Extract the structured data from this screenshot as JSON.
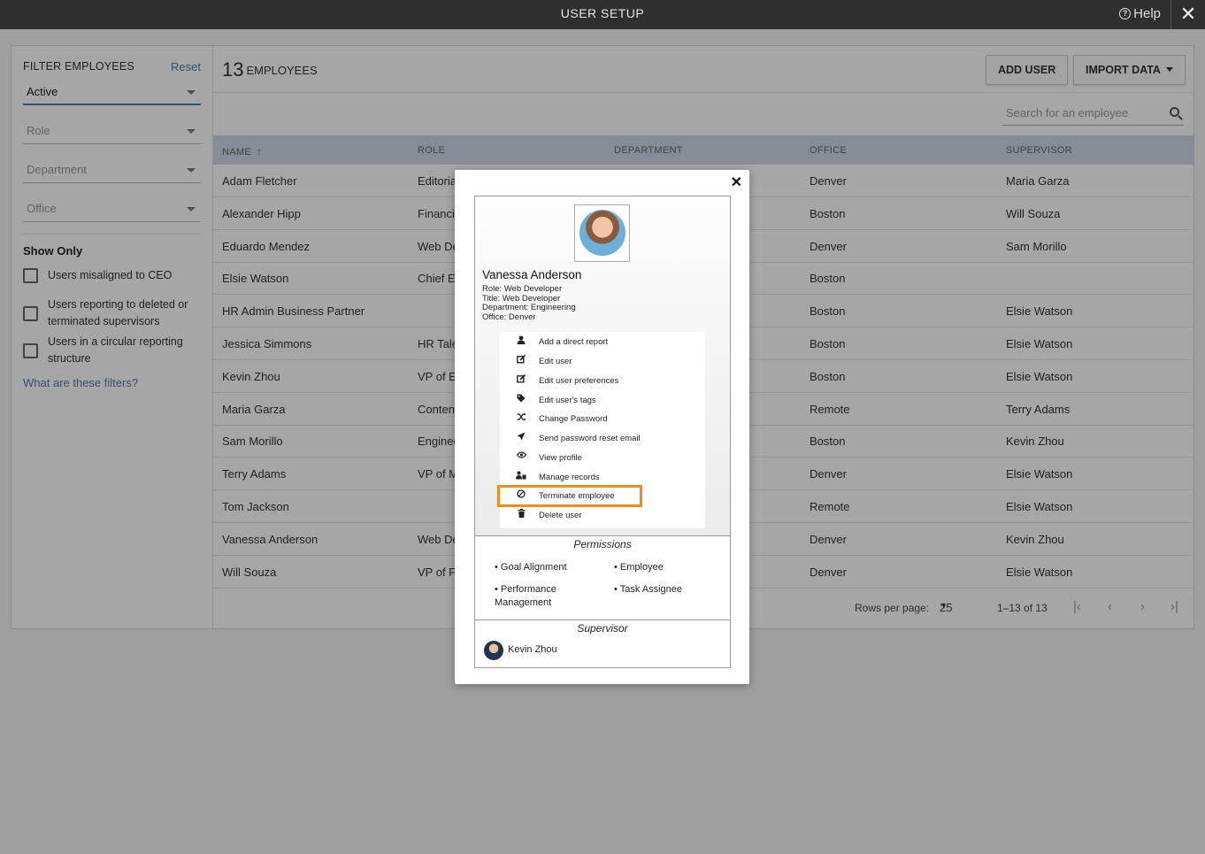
{
  "topbar": {
    "title": "USER SETUP",
    "help": "Help",
    "close": "✕"
  },
  "filters": {
    "heading": "FILTER EMPLOYEES",
    "reset": "Reset",
    "status_value": "Active",
    "role_placeholder": "Role",
    "department_placeholder": "Department",
    "office_placeholder": "Office",
    "show_only": "Show Only",
    "checkboxes": [
      {
        "label": "Users misaligned to CEO"
      },
      {
        "label": "Users reporting to deleted or terminated supervisors"
      },
      {
        "label": "Users in a circular reporting structure"
      }
    ],
    "what_link": "What are these filters?"
  },
  "header": {
    "count": "13",
    "count_label": "EMPLOYEES",
    "add_user": "ADD USER",
    "import_data": "IMPORT DATA"
  },
  "search": {
    "placeholder": "Search for an employee"
  },
  "table": {
    "columns": [
      "NAME",
      "ROLE",
      "DEPARTMENT",
      "OFFICE",
      "SUPERVISOR"
    ],
    "sort_indicator": "↑",
    "rows": [
      {
        "name": "Adam Fletcher",
        "role": "Editoria",
        "office": "Denver",
        "supervisor": "Maria Garza"
      },
      {
        "name": "Alexander Hipp",
        "role": "Financi",
        "office": "Boston",
        "supervisor": "Will Souza"
      },
      {
        "name": "Eduardo Mendez",
        "role": "Web De",
        "office": "Denver",
        "supervisor": "Sam Morillo"
      },
      {
        "name": "Elsie Watson",
        "role": "Chief E",
        "office": "Boston",
        "supervisor": ""
      },
      {
        "name": "HR Admin Business Partner",
        "role": "",
        "office": "Boston",
        "supervisor": "Elsie Watson"
      },
      {
        "name": "Jessica Simmons",
        "role": "HR Tale",
        "office": "Boston",
        "supervisor": "Elsie Watson"
      },
      {
        "name": "Kevin Zhou",
        "role": "VP of E",
        "office": "Boston",
        "supervisor": "Elsie Watson"
      },
      {
        "name": "Maria Garza",
        "role": "Conten",
        "office": "Remote",
        "supervisor": "Terry Adams"
      },
      {
        "name": "Sam Morillo",
        "role": "Enginee",
        "office": "Boston",
        "supervisor": "Kevin Zhou"
      },
      {
        "name": "Terry Adams",
        "role": "VP of M",
        "office": "Denver",
        "supervisor": "Elsie Watson"
      },
      {
        "name": "Tom Jackson",
        "role": "",
        "office": "Remote",
        "supervisor": "Elsie Watson"
      },
      {
        "name": "Vanessa Anderson",
        "role": "Web De",
        "office": "Denver",
        "supervisor": "Kevin Zhou"
      },
      {
        "name": "Will Souza",
        "role": "VP of F",
        "office": "Denver",
        "supervisor": "Elsie Watson"
      }
    ]
  },
  "pagination": {
    "rows_per_page_label": "Rows per page:",
    "rows_per_page": "25",
    "range": "1–13 of 13"
  },
  "modal": {
    "close": "✕",
    "name": "Vanessa Anderson",
    "role": "Role: Web Developer",
    "title": "Title: Web Developer",
    "department": "Department: Engineering",
    "office": "Office: Denver",
    "menu": [
      {
        "icon": "person-icon",
        "label": "Add a direct report"
      },
      {
        "icon": "edit-icon",
        "label": "Edit user"
      },
      {
        "icon": "edit-icon",
        "label": "Edit user preferences"
      },
      {
        "icon": "tags-icon",
        "label": "Edit user's tags"
      },
      {
        "icon": "shuffle-icon",
        "label": "Change Password"
      },
      {
        "icon": "send-icon",
        "label": "Send password reset email"
      },
      {
        "icon": "eye-icon",
        "label": "View profile"
      },
      {
        "icon": "records-icon",
        "label": "Manage records"
      },
      {
        "icon": "ban-icon",
        "label": "Terminate employee"
      },
      {
        "icon": "trash-icon",
        "label": "Delete user"
      }
    ],
    "permissions_title": "Permissions",
    "permissions": [
      "• Goal Alignment",
      "• Employee",
      "• Performance Management",
      "• Task Assignee"
    ],
    "supervisor_title": "Supervisor",
    "supervisor_name": "Kevin Zhou"
  },
  "colors": {
    "accent": "#4a7fb0",
    "highlight": "#f28b1a",
    "table_header": "#ccd9e6",
    "topbar": "#2f2f2f"
  }
}
